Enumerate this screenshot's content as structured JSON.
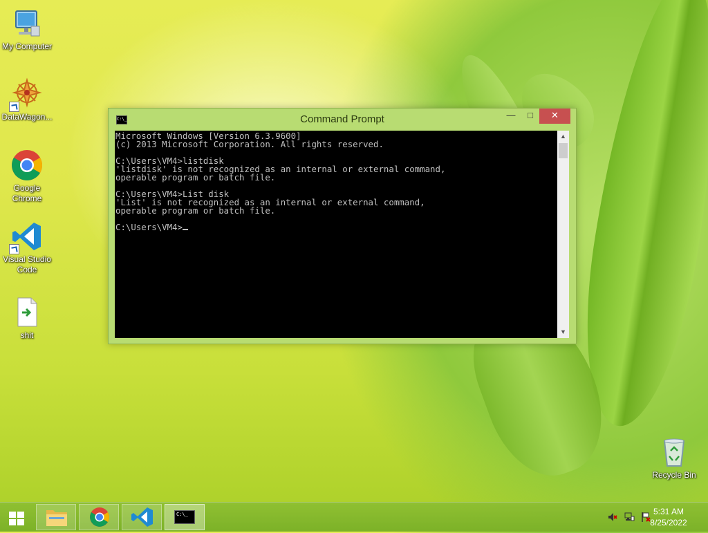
{
  "desktop": {
    "icons": [
      {
        "label": "My Computer",
        "icon": "computer-icon"
      },
      {
        "label": "DataWagon...",
        "icon": "datawagon-icon"
      },
      {
        "label": "Google Chrome",
        "icon": "chrome-icon"
      },
      {
        "label": "Visual Studio Code",
        "icon": "vscode-icon"
      },
      {
        "label": "shit",
        "icon": "file-icon"
      },
      {
        "label": "Recycle Bin",
        "icon": "recycle-bin-icon"
      }
    ]
  },
  "window": {
    "title": "Command Prompt",
    "titlebar_icon_text": "C:\\_",
    "buttons": {
      "minimize": "—",
      "maximize": "□",
      "close": "✕"
    },
    "console_text": "Microsoft Windows [Version 6.3.9600]\n(c) 2013 Microsoft Corporation. All rights reserved.\n\nC:\\Users\\VM4>listdisk\n'listdisk' is not recognized as an internal or external command,\noperable program or batch file.\n\nC:\\Users\\VM4>List disk\n'List' is not recognized as an internal or external command,\noperable program or batch file.\n\nC:\\Users\\VM4>",
    "scroll": {
      "up": "▲",
      "down": "▼"
    }
  },
  "taskbar": {
    "start_icon": "windows-logo-icon",
    "buttons": [
      {
        "name": "file-explorer",
        "icon": "folder-icon"
      },
      {
        "name": "google-chrome",
        "icon": "chrome-icon"
      },
      {
        "name": "visual-studio-code",
        "icon": "vscode-icon"
      },
      {
        "name": "command-prompt",
        "icon": "cmd-icon",
        "active": true,
        "text": "C:\\_"
      }
    ],
    "tray": {
      "icons": [
        "speaker-muted-icon",
        "network-icon",
        "action-center-flag-icon"
      ],
      "time": "5:31 AM",
      "date": "8/25/2022"
    }
  },
  "colors": {
    "close_button": "#c75050",
    "window_frame": "#b8dc72",
    "console_bg": "#000000",
    "console_fg": "#c0c0c0"
  }
}
